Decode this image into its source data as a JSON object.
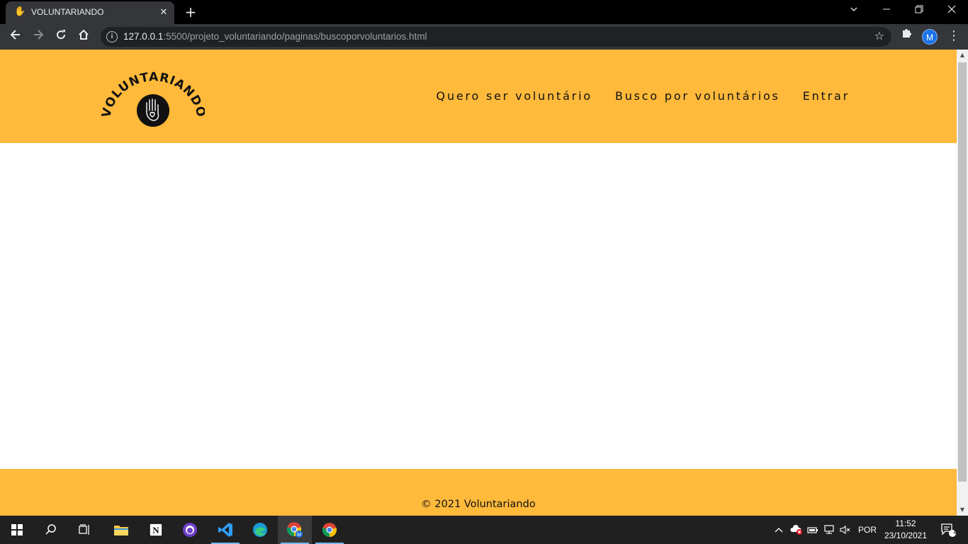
{
  "browser": {
    "tab_title": "VOLUNTARIANDO",
    "url_host": "127.0.0.1",
    "url_rest": ":5500/projeto_voluntariando/paginas/buscoporvoluntarios.html",
    "profile_initial": "M"
  },
  "site": {
    "logo_text": "VOLUNTARIANDO",
    "nav": [
      {
        "label": "Quero ser voluntário"
      },
      {
        "label": "Busco por voluntários"
      },
      {
        "label": "Entrar"
      }
    ],
    "footer": "© 2021 Voluntariando",
    "colors": {
      "brand": "#ffb93b",
      "text": "#111111"
    }
  },
  "taskbar": {
    "language": "POR",
    "time": "11:52",
    "date": "23/10/2021",
    "notification_count": "1"
  }
}
